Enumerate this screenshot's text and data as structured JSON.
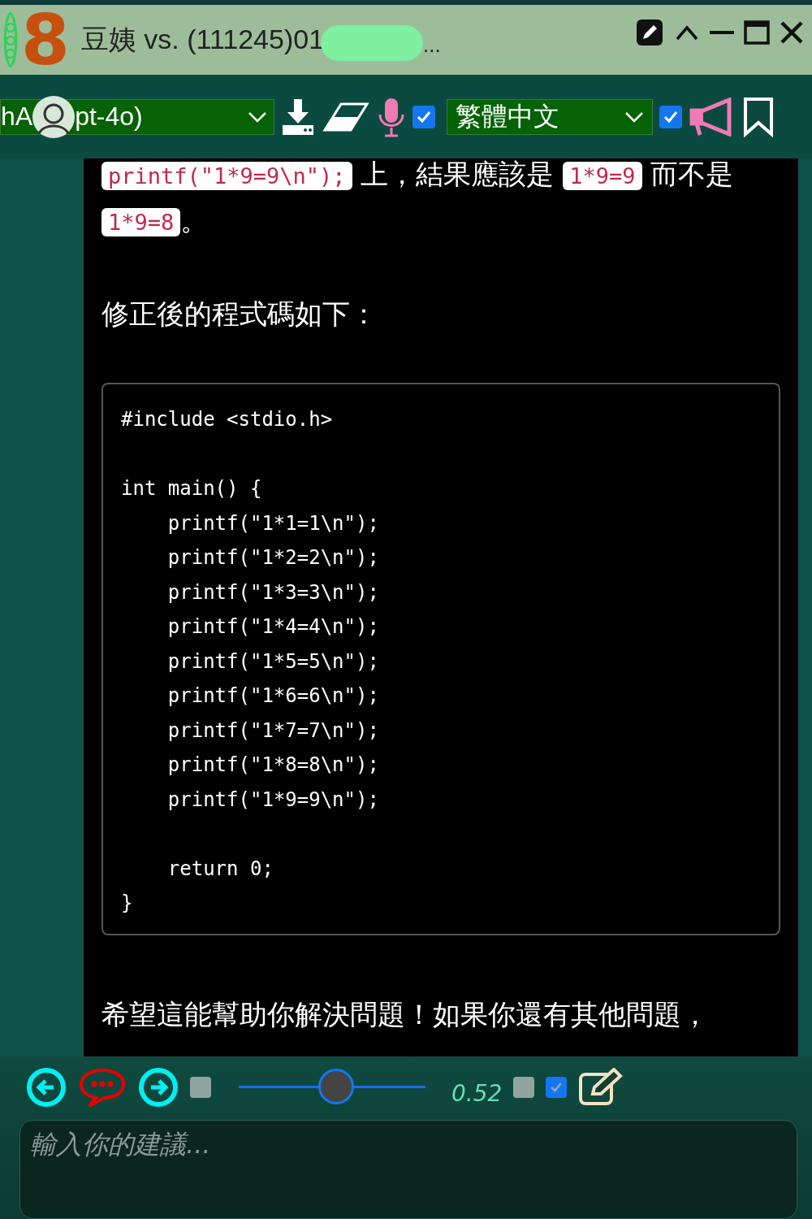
{
  "window": {
    "logo": "8",
    "title": "豆姨 vs. (111245)01",
    "title_tail": "..."
  },
  "toolbar": {
    "model_select": {
      "value_start": "hA",
      "value_end": "pt-4o)"
    },
    "option_1_checked": true,
    "language_select": {
      "value": "繁體中文"
    },
    "option_2_checked": true
  },
  "content": [
    {
      "kind": "paragraph",
      "segments": [
        {
          "kind": "code",
          "text": "printf(\"1*9=9\\n\");"
        },
        {
          "kind": "text",
          "text": " 上，結果應該是 "
        },
        {
          "kind": "code",
          "text": "1*9=9"
        },
        {
          "kind": "text",
          "text": " 而不是 "
        },
        {
          "kind": "code",
          "text": "1*9=8"
        },
        {
          "kind": "text",
          "text": "。"
        }
      ]
    },
    {
      "kind": "paragraph",
      "text": "修正後的程式碼如下："
    },
    {
      "kind": "code_block",
      "lines": [
        {
          "kind": "code",
          "text": "#include <stdio.h>"
        },
        {
          "kind": "blank"
        },
        {
          "kind": "code",
          "text": "int main() {"
        },
        {
          "kind": "code",
          "text": "    printf(\"1*1=1\\n\");"
        },
        {
          "kind": "code",
          "text": "    printf(\"1*2=2\\n\");"
        },
        {
          "kind": "code",
          "text": "    printf(\"1*3=3\\n\");"
        },
        {
          "kind": "code",
          "text": "    printf(\"1*4=4\\n\");"
        },
        {
          "kind": "code",
          "text": "    printf(\"1*5=5\\n\");"
        },
        {
          "kind": "code",
          "text": "    printf(\"1*6=6\\n\");"
        },
        {
          "kind": "code",
          "text": "    printf(\"1*7=7\\n\");"
        },
        {
          "kind": "code",
          "text": "    printf(\"1*8=8\\n\");"
        },
        {
          "kind": "code",
          "text": "    printf(\"1*9=9\\n\");"
        },
        {
          "kind": "blank"
        },
        {
          "kind": "code",
          "text": "    return 0;"
        },
        {
          "kind": "code",
          "text": "}"
        }
      ]
    },
    {
      "kind": "paragraph",
      "text": "希望這能幫助你解決問題！如果你還有其他問題，"
    }
  ],
  "controls": {
    "option_3_checked": false,
    "slider": {
      "level": 0.52
    },
    "slider_reading": "0.52",
    "option_4_checked": false,
    "option_5_checked": true
  },
  "input": {
    "placeholder": "輸入你的建議..."
  }
}
